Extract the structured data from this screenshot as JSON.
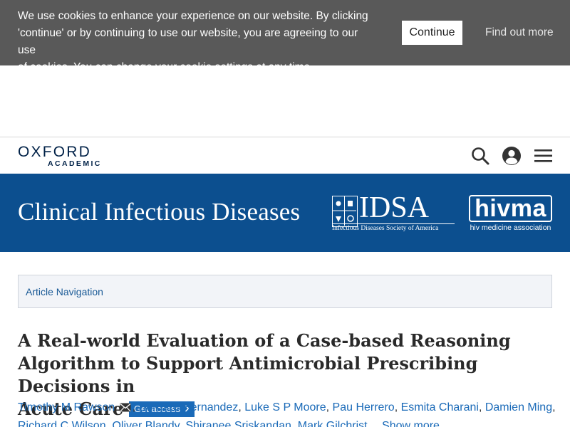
{
  "cookie_banner": {
    "line1": "We use cookies to enhance your experience on our website. By clicking",
    "line2": "'continue' or by continuing to use our website, you are agreeing to our use",
    "line3": "of cookies. You can change your cookie settings at any time.",
    "continue_label": "Continue",
    "find_out_more_label": "Find out more"
  },
  "top_nav": {
    "logo_main": "OXFORD",
    "logo_sub": "ACADEMIC",
    "icons": [
      "search-icon",
      "user-icon",
      "menu-icon"
    ]
  },
  "journal_header": {
    "title": "Clinical Infectious Diseases",
    "idsa_text": "IDSA",
    "idsa_sub": "Infectious Diseases Society of America",
    "hivma_text": "hivma",
    "hivma_sub": "hiv medicine association",
    "background_color": "#0c4f8f"
  },
  "article_nav": {
    "label": "Article Navigation"
  },
  "article": {
    "title_line1": "A Real-world Evaluation of a Case-based Reasoning",
    "title_line2": "Algorithm to Support Antimicrobial Prescribing Decisions in",
    "title_line3": "Acute Care",
    "get_access_label": "Get access",
    "authors_row1": [
      "Timothy M Rawson",
      "Bernard Hernandez",
      "Luke S P Moore",
      "Pau Herrero",
      "Esmita Charani",
      "Damien Ming"
    ],
    "authors_row2": [
      "Richard C Wilson",
      "Oliver Blandy",
      "Shiranee Sriskandan",
      "Mark Gilchrist"
    ],
    "show_more_label": "Show more"
  }
}
